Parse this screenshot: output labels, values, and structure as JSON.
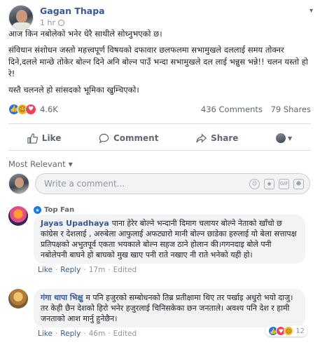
{
  "post": {
    "author": "Gagan Thapa",
    "time": "1 hr",
    "paragraphs": [
      "आज किन नबोलेको भनेर धेरै साथीले सोध्नुभएको छ।",
      "संविधान संशोधन जस्तो महत्त्वपूर्ण विषयको दफावार छलफलमा सभामुखले दललाई समय तोक्नर दिने,दलले मान्छे तोकेर बोल्न दिने अनि बोल्न पाउँ भन्दा सभामुखले दल लाई भन्नुस भन्ने!! चलन यस्तो हो रे!",
      "यस्तै चलनले हो सांसदको भूमिका खुम्चिएको।"
    ]
  },
  "reactions": {
    "count": "4.6K",
    "types": [
      "like",
      "haha",
      "love"
    ]
  },
  "stats": {
    "comments": "436 Comments",
    "shares": "79 Shares"
  },
  "actions": {
    "like": "Like",
    "comment": "Comment",
    "share": "Share"
  },
  "sort": {
    "label": "Most Relevant"
  },
  "composer": {
    "placeholder": "Write a comment..."
  },
  "comments": [
    {
      "badge": "Top Fan",
      "name": "Jayas Upadhaya",
      "text": "पाना हेरेर बोल्ने भन्दानी दिमाग चलायर बोल्ने नेताको खाँचो छ कांग्रेस र देशलाई , अरुबेला आफुलाई अफट्यारो मानी बोल्न छाडेका हरुलाई यो बेला सत्तापक्ष प्रतिपक्षको अभुतपूर्व एकता भयकाले बोल्न सहज ठाने होलान की।गगनदाइ बोले पनी नबोलेपनी बाघने हो बाघको मुख खाए पनी राते नखाए नी राते भनेको यही हो।",
      "like": "Like",
      "reply": "Reply",
      "time": "17m",
      "edited": "Edited"
    },
    {
      "name": "गंगा थापा भिक्षु",
      "text": "म पनि हजुरको सम्बोधनको तिब्र प्रतीक्षामा थिए तर पर्खाइ अधुरो भयो दाजु। तर केही छैन देशको हिरो भनेर हजुरलाई चिनिसकेका छन जनताले। अवश्य पनि देश र हामी जनताको आश मार्नु हुनेछैन।",
      "like": "Like",
      "reply": "Reply",
      "time": "46m",
      "edited": "Edited",
      "reaction_count": "12"
    }
  ],
  "colors": {
    "link": "#385898",
    "accent": "#1877f2",
    "muted": "#606770"
  },
  "icons": [
    "globe-icon",
    "chevron-down-icon",
    "like-icon",
    "comment-icon",
    "share-icon",
    "emoji-icon",
    "camera-icon",
    "gif-icon",
    "sticker-icon"
  ]
}
